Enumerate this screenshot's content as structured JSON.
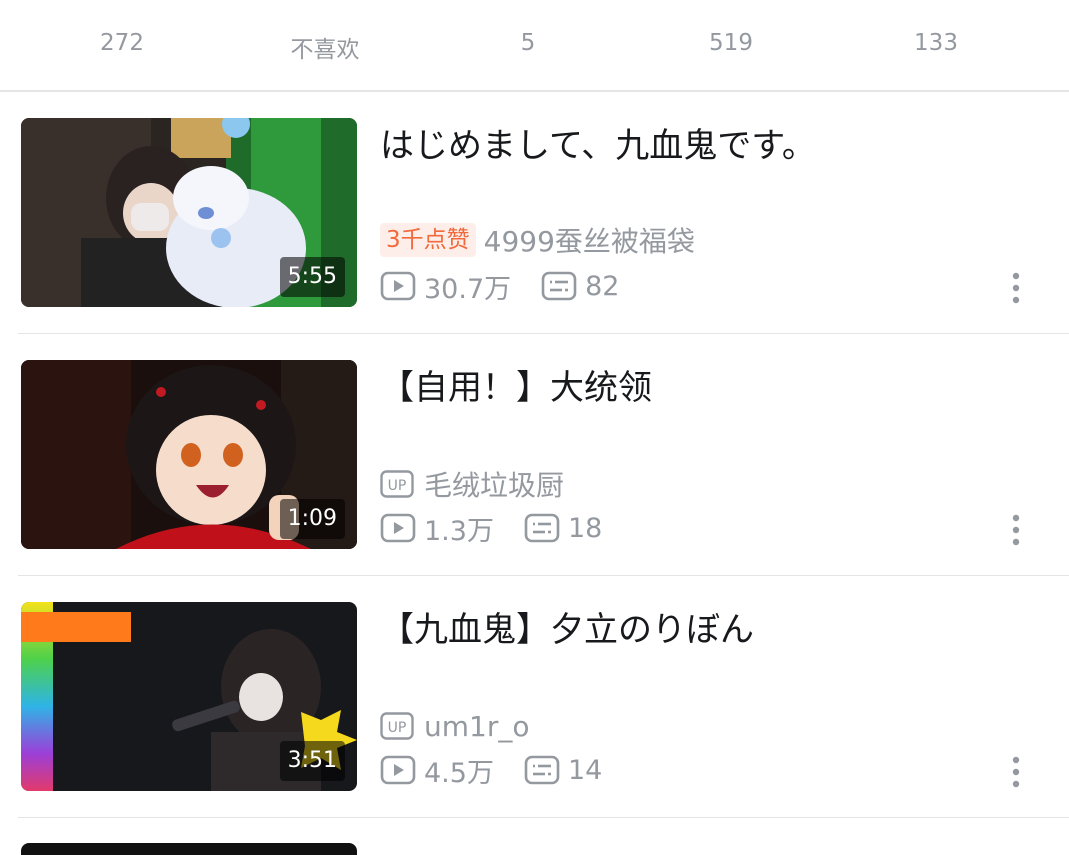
{
  "action_bar": {
    "items": [
      {
        "icon": "like-icon",
        "label": "272"
      },
      {
        "icon": "dislike-icon",
        "label": "不喜欢"
      },
      {
        "icon": "coin-icon",
        "label": "5"
      },
      {
        "icon": "favorite-icon",
        "label": "519"
      },
      {
        "icon": "share-icon",
        "label": "133"
      }
    ]
  },
  "videos": [
    {
      "title": "はじめまして、九血鬼です。",
      "duration": "5:55",
      "badge": "3千点赞",
      "uploader": "4999蚕丝被福袋",
      "views": "30.7万",
      "comments": "82"
    },
    {
      "title": "【自用！】大统领",
      "duration": "1:09",
      "up_label": "UP",
      "uploader": "毛绒垃圾厨",
      "views": "1.3万",
      "comments": "18"
    },
    {
      "title": "【九血鬼】夕立のりぼん",
      "duration": "3:51",
      "up_label": "UP",
      "uploader": "um1r_o",
      "views": "4.5万",
      "comments": "14"
    }
  ],
  "colors": {
    "text_primary": "#18191c",
    "text_secondary": "#9499a0",
    "hot_badge_bg": "#fdeee9",
    "hot_badge_text": "#f06a3c",
    "divider": "#e3e5e7"
  }
}
